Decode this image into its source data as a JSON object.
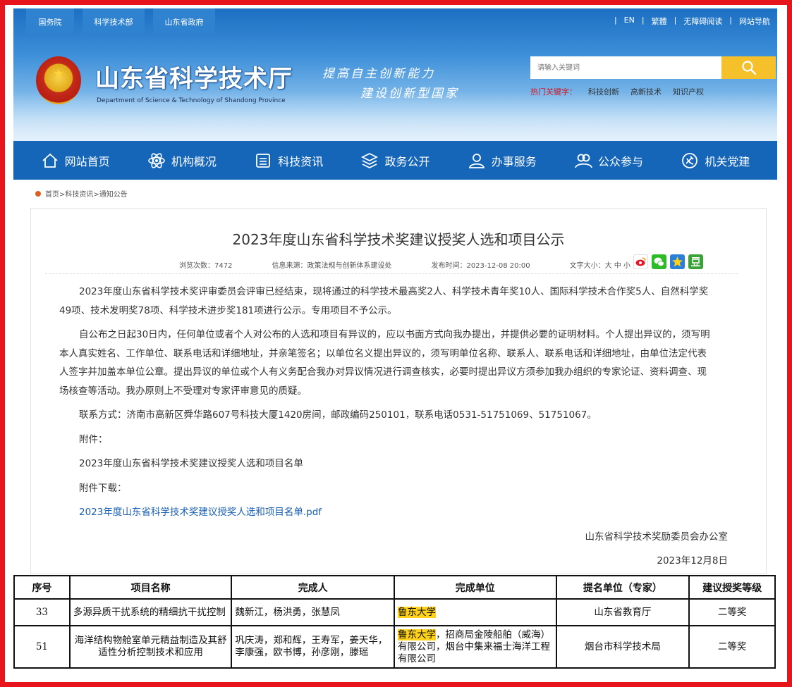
{
  "header": {
    "top_tabs": [
      "国务院",
      "科学技术部",
      "山东省政府"
    ],
    "top_links": [
      "|",
      "EN",
      "|",
      "繁體",
      "|",
      "无障碍阅读",
      "|",
      "网站导航"
    ],
    "site_title": "山东省科学技术厅",
    "site_subtitle": "Department of Science & Technology of Shandong Province",
    "slogan_line1": "提高自主创新能力",
    "slogan_line2": "建设创新型国家",
    "search_placeholder": "请输入关键词",
    "hot_label": "热门关键字：",
    "hot_words": [
      "科技创新",
      "高新技术",
      "知识产权"
    ]
  },
  "nav": {
    "items": [
      {
        "label": "网站首页",
        "icon": "home-icon"
      },
      {
        "label": "机构概况",
        "icon": "atom-icon"
      },
      {
        "label": "科技资讯",
        "icon": "list-icon"
      },
      {
        "label": "政务公开",
        "icon": "layers-icon"
      },
      {
        "label": "办事服务",
        "icon": "user-icon"
      },
      {
        "label": "公众参与",
        "icon": "users-icon"
      },
      {
        "label": "机关党建",
        "icon": "party-icon"
      }
    ]
  },
  "breadcrumb": "首页>科技资讯>通知公告",
  "article": {
    "title": "2023年度山东省科学技术奖建议授奖人选和项目公示",
    "meta": {
      "views_label": "浏览次数：",
      "views": "7472",
      "source_label": "信息来源：",
      "source": "政策法规与创新体系建设处",
      "time_label": "发布时间：",
      "time": "2023-12-08 20:00",
      "font_label": "文字大小：",
      "font_sizes": "大 中 小"
    },
    "share_icons": [
      "weibo-icon",
      "wechat-icon",
      "qzone-icon",
      "douban-icon"
    ],
    "para1": "2023年度山东省科学技术奖评审委员会评审已经结束，现将通过的科学技术最高奖2人、科学技术青年奖10人、国际科学技术合作奖5人、自然科学奖49项、技术发明奖78项、科学技术进步奖181项进行公示。专用项目不予公示。",
    "para2": "自公布之日起30日内，任何单位或者个人对公布的人选和项目有异议的，应以书面方式向我办提出，并提供必要的证明材料。个人提出异议的，须写明本人真实姓名、工作单位、联系电话和详细地址，并亲笔签名；以单位名义提出异议的，须写明单位名称、联系人、联系电话和详细地址，由单位法定代表人签字并加盖本单位公章。提出异议的单位或个人有义务配合我办对异议情况进行调查核实，必要时提出异议方须参加我办组织的专家论证、资料调查、现场核查等活动。我办原则上不受理对专家评审意见的质疑。",
    "contact": "联系方式：济南市高新区舜华路607号科技大厦1420房间，邮政编码250101，联系电话0531-51751069、51751067。",
    "attach_label": "附件：",
    "attach_name": "2023年度山东省科学技术奖建议授奖人选和项目名单",
    "download_label": "附件下载：",
    "download_link": "2023年度山东省科学技术奖建议授奖人选和项目名单.pdf",
    "signature": "山东省科学技术奖励委员会办公室",
    "date": "2023年12月8日"
  },
  "table": {
    "headers": [
      "序号",
      "项目名称",
      "完成人",
      "完成单位",
      "提名单位（专家）",
      "建议授奖等级"
    ],
    "rows": [
      {
        "no": "33",
        "name": "多源异质干扰系统的精细抗干扰控制",
        "people": "魏新江，杨洪勇，张慧凤",
        "unit_hl": "鲁东大学",
        "unit_rest": "",
        "nominator": "山东省教育厅",
        "level": "二等奖"
      },
      {
        "no": "51",
        "name": "海洋结构物舱室单元精益制造及其舒适性分析控制技术和应用",
        "people": "巩庆涛，郑和辉，王寿军，姜天华，李康强，欧书博，孙彦刚，滕瑶",
        "unit_hl": "鲁东大学",
        "unit_rest": "，招商局金陵船舶（威海）有限公司，烟台中集来福士海洋工程有限公司",
        "nominator": "烟台市科学技术局",
        "level": "二等奖"
      }
    ]
  },
  "colors": {
    "frame": "#e8141b",
    "nav_bg": "#1565b9",
    "search_button": "#f6c02a",
    "highlight": "#ffd21a",
    "link": "#1a5fb4"
  }
}
